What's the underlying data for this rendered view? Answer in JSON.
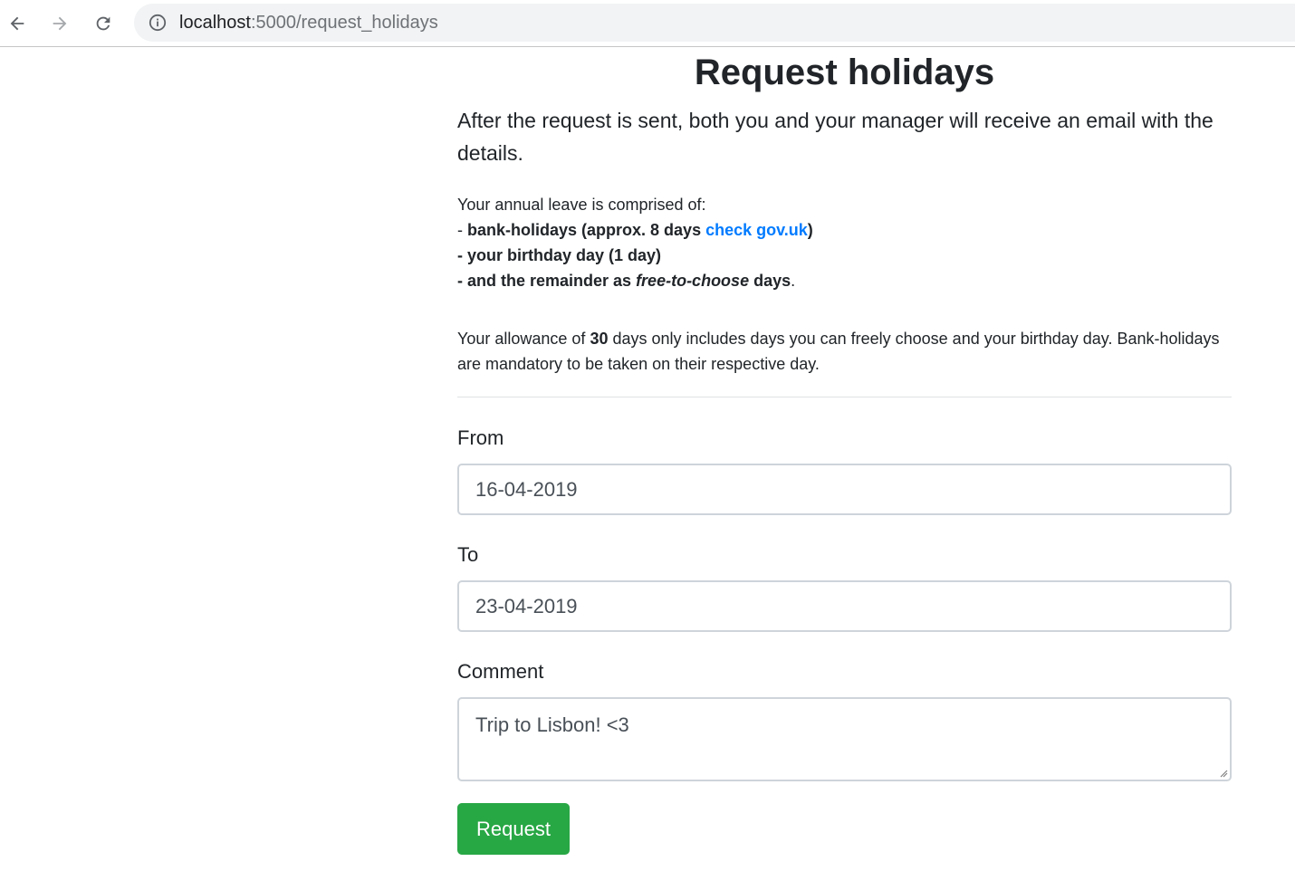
{
  "browser": {
    "url_host": "localhost",
    "url_path": ":5000/request_holidays",
    "icons": {
      "back": "arrow-back-icon",
      "forward": "arrow-forward-icon",
      "reload": "reload-icon",
      "info": "info-icon"
    }
  },
  "page": {
    "title": "Request holidays",
    "lead": "After the request is sent, both you and your manager will receive an email with the details.",
    "leave": {
      "intro": "Your annual leave is comprised of:",
      "bank_holidays_prefix": "- bank-holidays (approx. 8 days ",
      "bank_holidays_link": "check gov.uk",
      "bank_holidays_suffix": ")",
      "birthday": "- your birthday day (1 day)",
      "remainder_prefix": "- and the remainder as ",
      "remainder_emph": "free-to-choose",
      "remainder_suffix": " days",
      "remainder_period": "."
    },
    "allowance": {
      "prefix": "Your allowance of ",
      "days": "30",
      "suffix": " days only includes days you can freely choose and your birthday day. Bank-holidays are mandatory to be taken on their respective day."
    },
    "form": {
      "from_label": "From",
      "from_value": "16-04-2019",
      "to_label": "To",
      "to_value": "23-04-2019",
      "comment_label": "Comment",
      "comment_value": "Trip to Lisbon! <3",
      "submit_label": "Request"
    }
  },
  "colors": {
    "link": "#007bff",
    "button": "#28a745",
    "text": "#212529"
  }
}
